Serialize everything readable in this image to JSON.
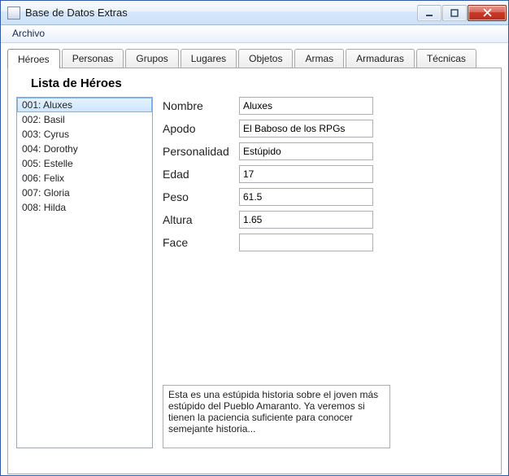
{
  "window": {
    "title": "Base de Datos Extras"
  },
  "menu": {
    "archivo": "Archivo"
  },
  "tabs": [
    {
      "label": "Héroes",
      "active": true
    },
    {
      "label": "Personas",
      "active": false
    },
    {
      "label": "Grupos",
      "active": false
    },
    {
      "label": "Lugares",
      "active": false
    },
    {
      "label": "Objetos",
      "active": false
    },
    {
      "label": "Armas",
      "active": false
    },
    {
      "label": "Armaduras",
      "active": false
    },
    {
      "label": "Técnicas",
      "active": false
    }
  ],
  "heading": "Lista de Héroes",
  "heroes": [
    {
      "label": "001: Aluxes",
      "selected": true
    },
    {
      "label": "002: Basil",
      "selected": false
    },
    {
      "label": "003: Cyrus",
      "selected": false
    },
    {
      "label": "004: Dorothy",
      "selected": false
    },
    {
      "label": "005: Estelle",
      "selected": false
    },
    {
      "label": "006: Felix",
      "selected": false
    },
    {
      "label": "007: Gloria",
      "selected": false
    },
    {
      "label": "008: Hilda",
      "selected": false
    }
  ],
  "form": {
    "nombre": {
      "label": "Nombre",
      "value": "Aluxes"
    },
    "apodo": {
      "label": "Apodo",
      "value": "El Baboso de los RPGs"
    },
    "personalidad": {
      "label": "Personalidad",
      "value": "Estúpido"
    },
    "edad": {
      "label": "Edad",
      "value": "17"
    },
    "peso": {
      "label": "Peso",
      "value": "61.5"
    },
    "altura": {
      "label": "Altura",
      "value": "1.65"
    },
    "face": {
      "label": "Face",
      "value": ""
    }
  },
  "description": "Esta es una estúpida historia sobre el joven más estúpido del Pueblo Amaranto. Ya veremos si tienen la paciencia suficiente para conocer semejante historia..."
}
